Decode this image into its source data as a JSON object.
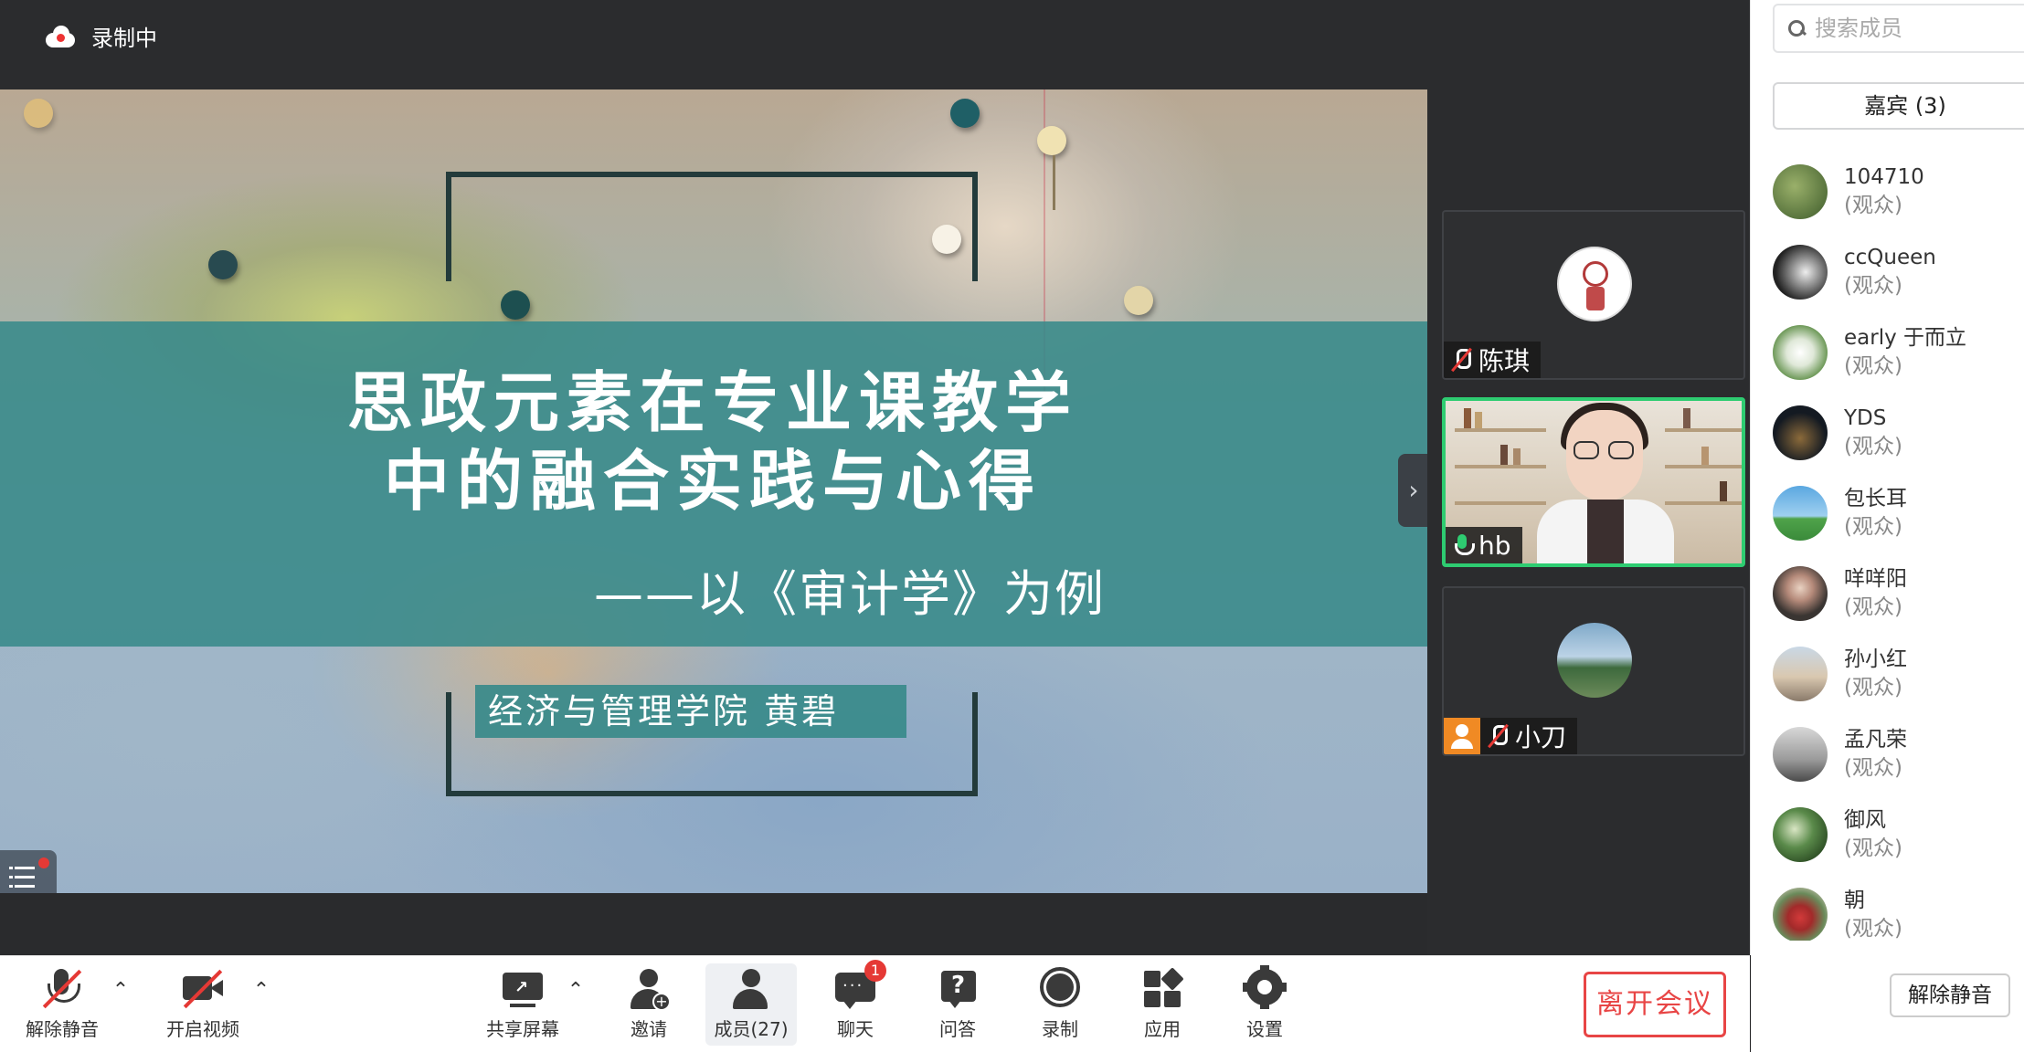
{
  "recording": {
    "label": "录制中"
  },
  "slide": {
    "title_line1": "思政元素在专业课教学",
    "title_line2": "中的融合实践与心得",
    "subtitle": "——以《审计学》为例",
    "author": "经济与管理学院   黄碧"
  },
  "tiles": [
    {
      "name": "陈琪",
      "mic": "muted",
      "avatar_color": "#ffffff"
    },
    {
      "name": "hb",
      "mic": "on",
      "active": true
    },
    {
      "name": "小刀",
      "mic": "muted",
      "avatar_color": "#7fa9c9"
    }
  ],
  "members_panel": {
    "search_placeholder": "搜索成员",
    "tab_label": "嘉宾 (3)",
    "members": [
      {
        "name": "104710",
        "role": "(观众)",
        "avatar_color": "#4c6b3a"
      },
      {
        "name": "ccQueen",
        "role": "(观众)",
        "avatar_color": "#2b2b2b"
      },
      {
        "name": "early 于而立",
        "role": "(观众)",
        "avatar_color": "#7fa06a"
      },
      {
        "name": "YDS",
        "role": "(观众)",
        "avatar_color": "#1d2630"
      },
      {
        "name": "包长耳",
        "role": "(观众)",
        "avatar_color": "#5aa7e0"
      },
      {
        "name": "咩咩阳",
        "role": "(观众)",
        "avatar_color": "#5a5550"
      },
      {
        "name": "孙小红",
        "role": "(观众)",
        "avatar_color": "#b8a99a"
      },
      {
        "name": "孟凡荣",
        "role": "(观众)",
        "avatar_color": "#7a7a7a"
      },
      {
        "name": "御风",
        "role": "(观众)",
        "avatar_color": "#3f6a3a"
      },
      {
        "name": "朝",
        "role": "(观众)",
        "avatar_color": "#b23a3a"
      }
    ],
    "unmute_all_label": "解除静音"
  },
  "toolbar": {
    "unmute_label": "解除静音",
    "video_label": "开启视频",
    "share_label": "共享屏幕",
    "invite_label": "邀请",
    "members_label": "成员(27)",
    "chat_label": "聊天",
    "chat_badge": "1",
    "qa_label": "问答",
    "record_label": "录制",
    "apps_label": "应用",
    "settings_label": "设置",
    "leave_label": "离开会议"
  },
  "colors": {
    "accent_red": "#e84545",
    "active_green": "#2ecc71",
    "slide_band": "#388a8a"
  }
}
